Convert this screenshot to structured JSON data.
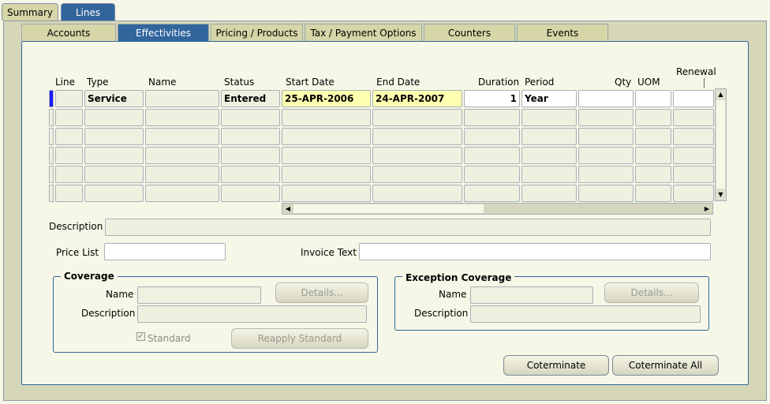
{
  "top_tabs": [
    {
      "label": "Summary",
      "active": false
    },
    {
      "label": "Lines",
      "active": true
    }
  ],
  "sub_tabs": [
    {
      "label": "Accounts",
      "active": false
    },
    {
      "label": "Effectivities",
      "active": true
    },
    {
      "label": "Pricing / Products",
      "active": false
    },
    {
      "label": "Tax / Payment Options",
      "active": false
    },
    {
      "label": "Counters",
      "active": false
    },
    {
      "label": "Events",
      "active": false
    }
  ],
  "grid": {
    "headers": {
      "line": "Line",
      "type": "Type",
      "name": "Name",
      "status": "Status",
      "start_date": "Start Date",
      "end_date": "End Date",
      "duration": "Duration",
      "period": "Period",
      "qty": "Qty",
      "uom": "UOM",
      "renewal": "Renewal"
    },
    "rows": [
      {
        "line": "",
        "type": "Service",
        "name": "",
        "status": "Entered",
        "start_date": "25-APR-2006",
        "end_date": "24-APR-2007",
        "duration": "1",
        "period": "Year",
        "qty": "",
        "uom": "",
        "renewal": ""
      }
    ]
  },
  "labels": {
    "description": "Description",
    "price_list": "Price List",
    "invoice_text": "Invoice Text"
  },
  "coverage": {
    "title": "Coverage",
    "name_label": "Name",
    "description_label": "Description",
    "details_button": "Details...",
    "standard_label": "Standard",
    "reapply_button": "Reapply Standard"
  },
  "exception_coverage": {
    "title": "Exception Coverage",
    "name_label": "Name",
    "description_label": "Description",
    "details_button": "Details..."
  },
  "buttons": {
    "coterminate": "Coterminate",
    "coterminate_all": "Coterminate All"
  }
}
